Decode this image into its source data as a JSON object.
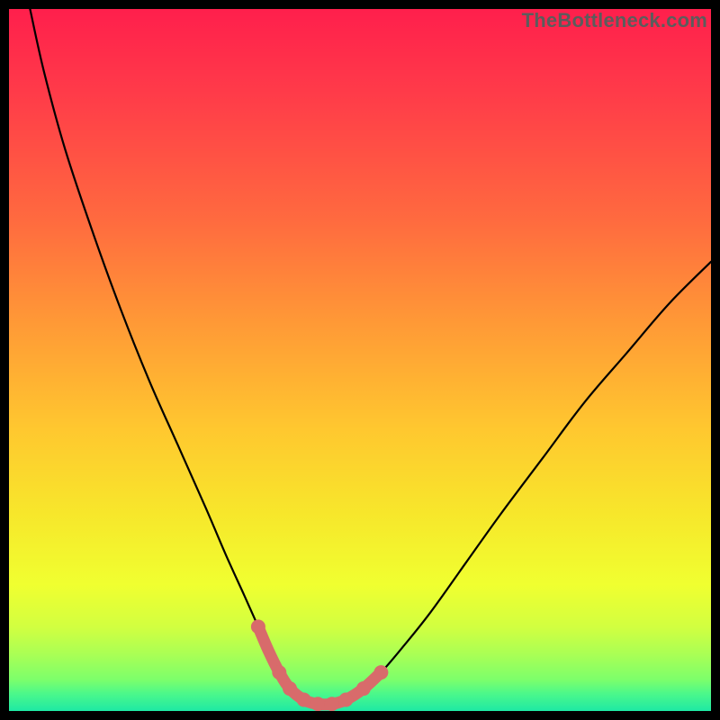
{
  "watermark": "TheBottleneck.com",
  "colors": {
    "background": "#000000",
    "gradient_stops": [
      {
        "offset": 0.0,
        "color": "#ff1f4c"
      },
      {
        "offset": 0.12,
        "color": "#ff3b49"
      },
      {
        "offset": 0.3,
        "color": "#ff6a3f"
      },
      {
        "offset": 0.45,
        "color": "#ff9a36"
      },
      {
        "offset": 0.6,
        "color": "#ffc82f"
      },
      {
        "offset": 0.72,
        "color": "#f7e72b"
      },
      {
        "offset": 0.82,
        "color": "#f0ff30"
      },
      {
        "offset": 0.88,
        "color": "#d2ff40"
      },
      {
        "offset": 0.92,
        "color": "#a9ff55"
      },
      {
        "offset": 0.955,
        "color": "#7dff6b"
      },
      {
        "offset": 0.975,
        "color": "#4cf88a"
      },
      {
        "offset": 1.0,
        "color": "#1ee9a4"
      }
    ],
    "curve": "#000000",
    "highlight": "#d86b6b"
  },
  "chart_data": {
    "type": "line",
    "title": "",
    "xlabel": "",
    "ylabel": "",
    "xlim": [
      0,
      100
    ],
    "ylim": [
      0,
      100
    ],
    "series": [
      {
        "name": "bottleneck-curve",
        "x": [
          3,
          5,
          8,
          12,
          16,
          20,
          24,
          28,
          31,
          33.5,
          35.5,
          37,
          38.5,
          40,
          42,
          44,
          46,
          48,
          50.5,
          53,
          56,
          60,
          65,
          70,
          76,
          82,
          88,
          94,
          100
        ],
        "y": [
          100,
          91,
          80,
          68,
          57,
          47,
          38,
          29,
          22,
          16.5,
          12,
          8.5,
          5.5,
          3.2,
          1.6,
          1.0,
          1.0,
          1.6,
          3.2,
          5.5,
          9,
          14,
          21,
          28,
          36,
          44,
          51,
          58,
          64
        ]
      }
    ],
    "highlight_segment": {
      "name": "bottom-highlight",
      "x": [
        35.5,
        37,
        38.5,
        40,
        42,
        44,
        46,
        48,
        50.5,
        53
      ],
      "y": [
        12,
        8.5,
        5.5,
        3.2,
        1.6,
        1.0,
        1.0,
        1.6,
        3.2,
        5.5
      ]
    },
    "highlight_dots": {
      "x": [
        35.5,
        38.5,
        40,
        42,
        44,
        46,
        48,
        50.5,
        53
      ],
      "y": [
        12,
        5.5,
        3.2,
        1.6,
        1.0,
        1.0,
        1.6,
        3.2,
        5.5
      ]
    }
  }
}
